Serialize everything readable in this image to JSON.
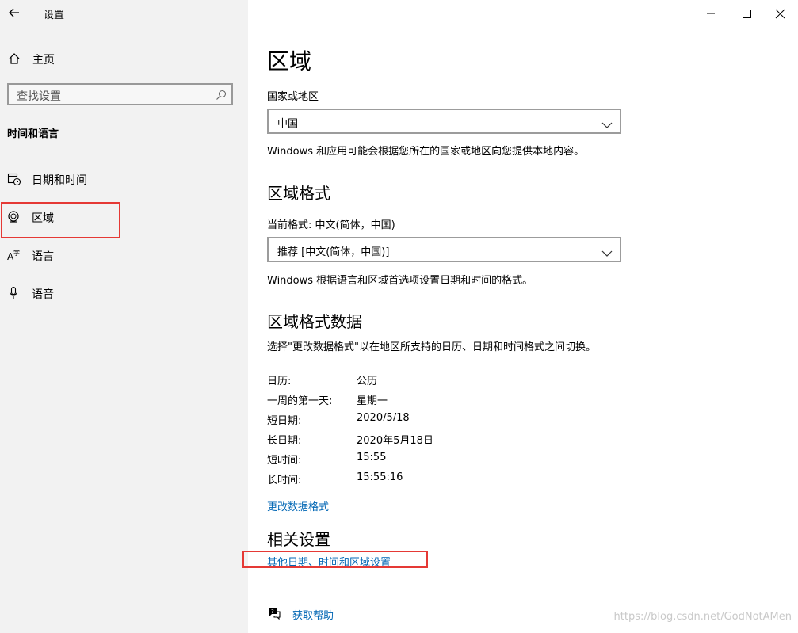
{
  "window": {
    "title": "设置"
  },
  "sidebar": {
    "home_label": "主页",
    "search_placeholder": "查找设置",
    "group_title": "时间和语言",
    "items": [
      {
        "label": "日期和时间",
        "icon": "calendar-clock-icon"
      },
      {
        "label": "区域",
        "icon": "globe-icon"
      },
      {
        "label": "语言",
        "icon": "language-icon"
      },
      {
        "label": "语音",
        "icon": "microphone-icon"
      }
    ]
  },
  "main": {
    "title": "区域",
    "country": {
      "label": "国家或地区",
      "value": "中国",
      "description": "Windows 和应用可能会根据您所在的国家或地区向您提供本地内容。"
    },
    "format": {
      "heading": "区域格式",
      "current_label": "当前格式: 中文(简体，中国)",
      "value": "推荐 [中文(简体，中国)]",
      "description": "Windows 根据语言和区域首选项设置日期和时间的格式。"
    },
    "format_data": {
      "heading": "区域格式数据",
      "description": "选择\"更改数据格式\"以在地区所支持的日历、日期和时间格式之间切换。",
      "rows": [
        {
          "key": "日历:",
          "value": "公历"
        },
        {
          "key": "一周的第一天:",
          "value": "星期一"
        },
        {
          "key": "短日期:",
          "value": "2020/5/18"
        },
        {
          "key": "长日期:",
          "value": "2020年5月18日"
        },
        {
          "key": "短时间:",
          "value": "15:55"
        },
        {
          "key": "长时间:",
          "value": "15:55:16"
        }
      ],
      "change_link": "更改数据格式"
    },
    "related": {
      "heading": "相关设置",
      "link": "其他日期、时间和区域设置"
    },
    "help_link": "获取帮助"
  },
  "watermark": "https://blog.csdn.net/GodNotAMen",
  "colors": {
    "accent": "#0066b4",
    "highlight": "#e53935",
    "sidebar_bg": "#f2f2f2"
  }
}
